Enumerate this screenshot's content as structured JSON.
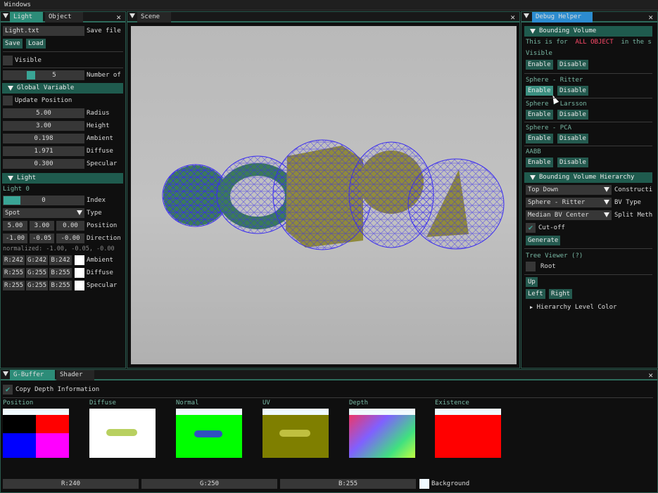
{
  "menubar": {
    "title": "Windows"
  },
  "left_panel": {
    "tabs": [
      "Light",
      "Object"
    ],
    "file_name": "Light.txt",
    "save_file_label": "Save file",
    "save_label": "Save",
    "load_label": "Load",
    "visible_label": "Visible",
    "number_value": "5",
    "number_label": "Number of",
    "global_header": "Global Variable",
    "update_position_label": "Update Position",
    "globals": [
      {
        "value": "5.00",
        "label": "Radius"
      },
      {
        "value": "3.00",
        "label": "Height"
      },
      {
        "value": "0.198",
        "label": "Ambient"
      },
      {
        "value": "1.971",
        "label": "Diffuse"
      },
      {
        "value": "0.300",
        "label": "Specular"
      }
    ],
    "light_header": "Light",
    "light_name": "Light 0",
    "index_value": "0",
    "index_label": "Index",
    "type_value": "Spot",
    "type_label": "Type",
    "position": [
      "5.00",
      "3.00",
      "0.00"
    ],
    "position_label": "Position",
    "direction": [
      "-1.00",
      "-0.05",
      "-0.00"
    ],
    "direction_label": "Direction",
    "normalized_text": "normalized: -1.00, -0.05, -0.00",
    "colors": [
      {
        "r": "R:242",
        "g": "G:242",
        "b": "B:242",
        "label": "Ambient"
      },
      {
        "r": "R:255",
        "g": "G:255",
        "b": "B:255",
        "label": "Diffuse"
      },
      {
        "r": "R:255",
        "g": "G:255",
        "b": "B:255",
        "label": "Specular"
      }
    ]
  },
  "scene_panel": {
    "tab": "Scene"
  },
  "debug_panel": {
    "tab": "Debug Helper",
    "bv_header": "Bounding Volume",
    "for_all_prefix": "This is for",
    "for_all_highlight": "ALL OBJECT",
    "for_all_suffix": "in the s",
    "sections": [
      {
        "title": "Visible"
      },
      {
        "title": "Sphere - Ritter"
      },
      {
        "title": "Sphere - Larsson"
      },
      {
        "title": "Sphere - PCA"
      },
      {
        "title": "AABB"
      }
    ],
    "enable_label": "Enable",
    "disable_label": "Disable",
    "bvh_header": "Bounding Volume Hierarchy",
    "construction_value": "Top Down",
    "construction_label": "Constructi",
    "bvtype_value": "Sphere - Ritter",
    "bvtype_label": "BV Type",
    "split_value": "Median BV Center",
    "split_label": "Split Meth",
    "cutoff_label": "Cut-off",
    "generate_label": "Generate",
    "tree_viewer_label": "Tree Viewer (?)",
    "root_label": "Root",
    "up_label": "Up",
    "left_label": "Left",
    "right_label": "Right",
    "hierarchy_color_label": "Hierarchy Level Color"
  },
  "bottom_panel": {
    "tabs": [
      "G-Buffer",
      "Shader"
    ],
    "copy_depth_label": "Copy Depth Information",
    "buffers": [
      "Position",
      "Diffuse",
      "Normal",
      "UV",
      "Depth",
      "Existence"
    ],
    "bg_r": "R:240",
    "bg_g": "G:250",
    "bg_b": "B:255",
    "background_label": "Background"
  },
  "colors": {
    "accent": "#2c8c78",
    "header": "#1f5b4e",
    "highlight": "#ff4a6a",
    "wire": "#3a2cf0",
    "object": "#8f8a3c"
  }
}
